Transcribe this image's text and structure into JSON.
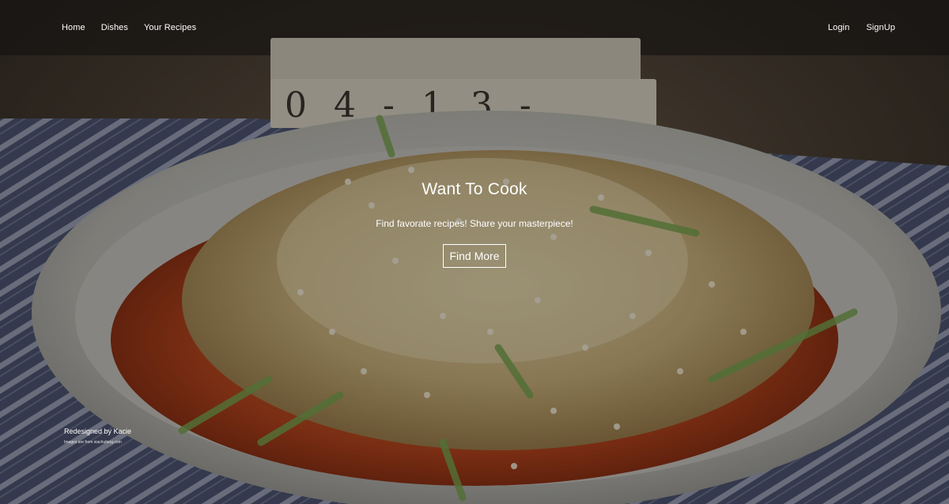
{
  "nav": {
    "left": [
      {
        "label": "Home"
      },
      {
        "label": "Dishes"
      },
      {
        "label": "Your Recipes"
      }
    ],
    "right": [
      {
        "label": "Login"
      },
      {
        "label": "SignUp"
      }
    ]
  },
  "hero": {
    "title": "Want To Cook",
    "subtitle": "Find favorate recipes! Share your masterpiece!",
    "cta_label": "Find More"
  },
  "footer": {
    "credit": "Redesigned by Kacie",
    "image_credit": "Images are from xiachufang.com"
  },
  "background": {
    "photo_subject": "bowl-of-noodle-salad-photo",
    "calendar_digits": "04-13-"
  }
}
